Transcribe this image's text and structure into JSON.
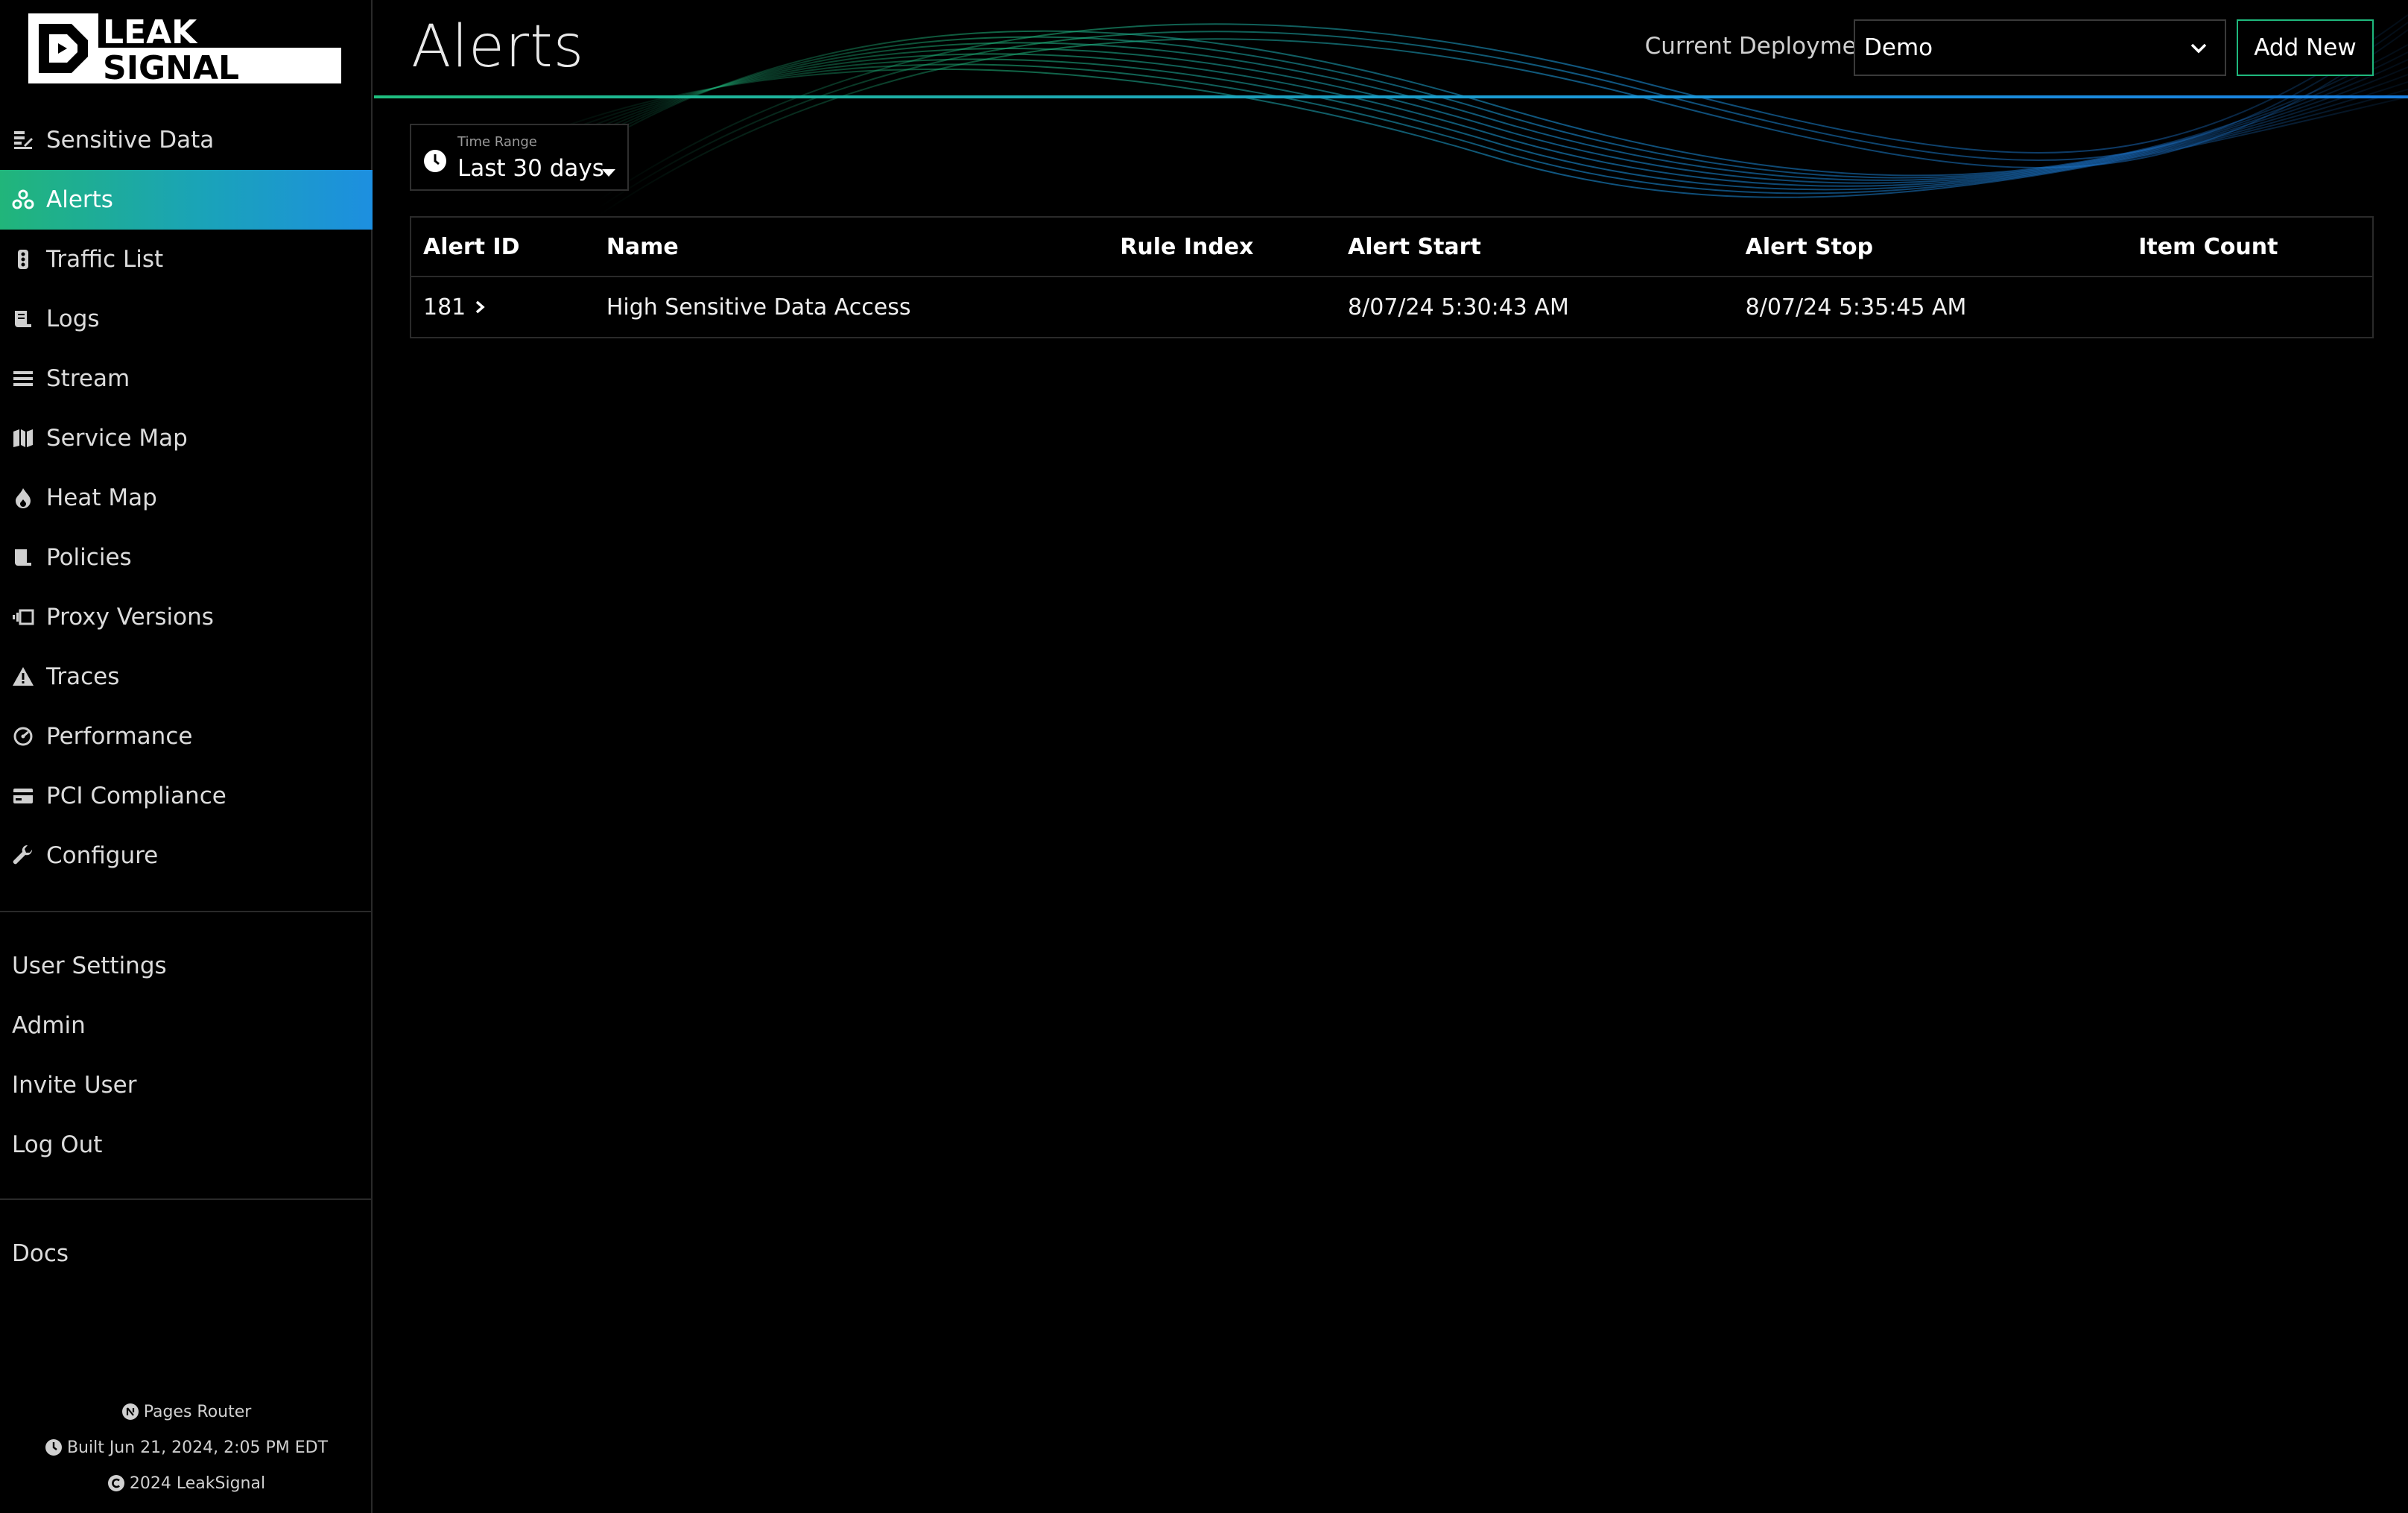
{
  "brand": {
    "line1": "LEAK",
    "line2": "SIGNAL"
  },
  "sidebar": {
    "items": [
      {
        "label": "Sensitive Data",
        "icon": "sensitive-data-icon",
        "active": false
      },
      {
        "label": "Alerts",
        "icon": "alerts-icon",
        "active": true
      },
      {
        "label": "Traffic List",
        "icon": "traffic-list-icon",
        "active": false
      },
      {
        "label": "Logs",
        "icon": "logs-icon",
        "active": false
      },
      {
        "label": "Stream",
        "icon": "stream-icon",
        "active": false
      },
      {
        "label": "Service Map",
        "icon": "service-map-icon",
        "active": false
      },
      {
        "label": "Heat Map",
        "icon": "heat-map-icon",
        "active": false
      },
      {
        "label": "Policies",
        "icon": "policies-icon",
        "active": false
      },
      {
        "label": "Proxy Versions",
        "icon": "proxy-versions-icon",
        "active": false
      },
      {
        "label": "Traces",
        "icon": "traces-icon",
        "active": false
      },
      {
        "label": "Performance",
        "icon": "performance-icon",
        "active": false
      },
      {
        "label": "PCI Compliance",
        "icon": "pci-compliance-icon",
        "active": false
      },
      {
        "label": "Configure",
        "icon": "configure-icon",
        "active": false
      }
    ],
    "account": [
      "User Settings",
      "Admin",
      "Invite User",
      "Log Out"
    ],
    "docs": "Docs",
    "footer": {
      "router": "Pages Router",
      "built": "Built Jun 21, 2024, 2:05 PM EDT",
      "copyright": "2024 LeakSignal"
    }
  },
  "header": {
    "title": "Alerts",
    "deployment_label": "Current Deployment:",
    "deployment_value": "Demo",
    "add_new": "Add New"
  },
  "time_range": {
    "label": "Time Range",
    "value": "Last 30 days"
  },
  "table": {
    "columns": [
      "Alert ID",
      "Name",
      "Rule Index",
      "Alert Start",
      "Alert Stop",
      "Item Count"
    ],
    "rows": [
      {
        "alert_id": "181",
        "name": "High Sensitive Data Access",
        "rule_index": "",
        "alert_start": "8/07/24 5:30:43 AM",
        "alert_stop": "8/07/24 5:35:45 AM",
        "item_count": ""
      }
    ]
  },
  "colors": {
    "accent_green": "#1fb87d",
    "accent_blue": "#1d8fe0",
    "background": "#000000"
  }
}
